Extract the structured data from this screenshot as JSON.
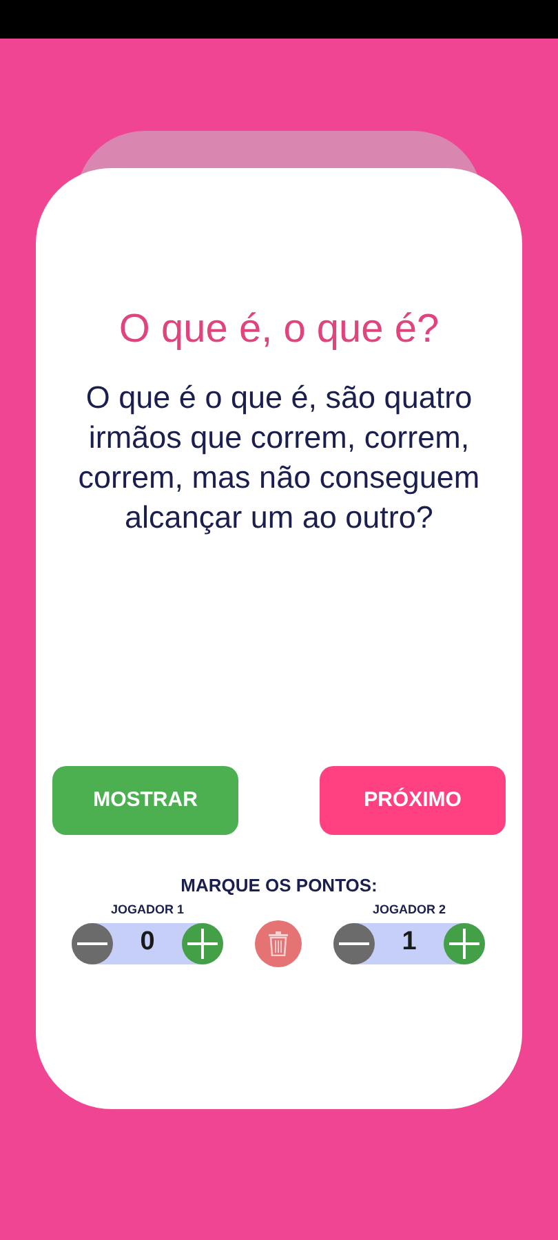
{
  "title": "O que é, o que é?",
  "question": "O que é o que é, são quatro irmãos que correm, correm, correm, mas não conseguem alcançar um ao outro?",
  "buttons": [
    {
      "label": "MOSTRAR",
      "kind": "show"
    },
    {
      "label": "PRÓXIMO",
      "kind": "next"
    }
  ],
  "score_heading": "MARQUE OS PONTOS:",
  "players": [
    {
      "label": "JOGADOR 1",
      "score": "0"
    },
    {
      "label": "JOGADOR 2",
      "score": "1"
    }
  ]
}
